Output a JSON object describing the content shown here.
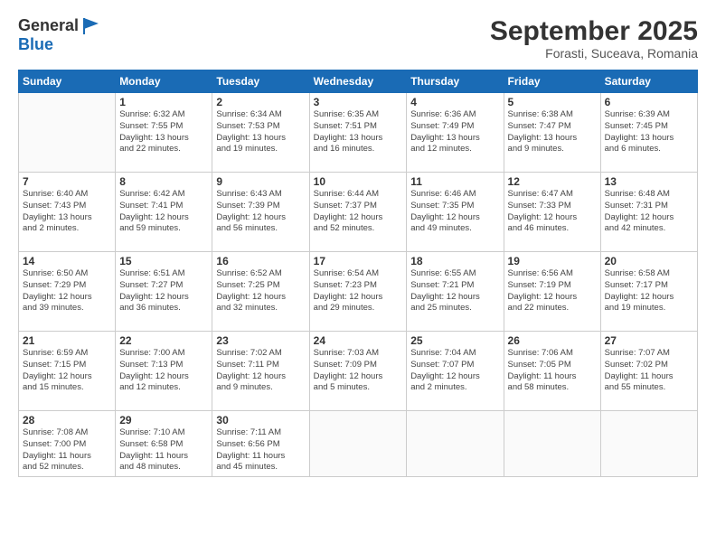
{
  "header": {
    "logo_line1": "General",
    "logo_line2": "Blue",
    "month_year": "September 2025",
    "location": "Forasti, Suceava, Romania"
  },
  "weekdays": [
    "Sunday",
    "Monday",
    "Tuesday",
    "Wednesday",
    "Thursday",
    "Friday",
    "Saturday"
  ],
  "weeks": [
    [
      {
        "day": "",
        "info": ""
      },
      {
        "day": "1",
        "info": "Sunrise: 6:32 AM\nSunset: 7:55 PM\nDaylight: 13 hours\nand 22 minutes."
      },
      {
        "day": "2",
        "info": "Sunrise: 6:34 AM\nSunset: 7:53 PM\nDaylight: 13 hours\nand 19 minutes."
      },
      {
        "day": "3",
        "info": "Sunrise: 6:35 AM\nSunset: 7:51 PM\nDaylight: 13 hours\nand 16 minutes."
      },
      {
        "day": "4",
        "info": "Sunrise: 6:36 AM\nSunset: 7:49 PM\nDaylight: 13 hours\nand 12 minutes."
      },
      {
        "day": "5",
        "info": "Sunrise: 6:38 AM\nSunset: 7:47 PM\nDaylight: 13 hours\nand 9 minutes."
      },
      {
        "day": "6",
        "info": "Sunrise: 6:39 AM\nSunset: 7:45 PM\nDaylight: 13 hours\nand 6 minutes."
      }
    ],
    [
      {
        "day": "7",
        "info": "Sunrise: 6:40 AM\nSunset: 7:43 PM\nDaylight: 13 hours\nand 2 minutes."
      },
      {
        "day": "8",
        "info": "Sunrise: 6:42 AM\nSunset: 7:41 PM\nDaylight: 12 hours\nand 59 minutes."
      },
      {
        "day": "9",
        "info": "Sunrise: 6:43 AM\nSunset: 7:39 PM\nDaylight: 12 hours\nand 56 minutes."
      },
      {
        "day": "10",
        "info": "Sunrise: 6:44 AM\nSunset: 7:37 PM\nDaylight: 12 hours\nand 52 minutes."
      },
      {
        "day": "11",
        "info": "Sunrise: 6:46 AM\nSunset: 7:35 PM\nDaylight: 12 hours\nand 49 minutes."
      },
      {
        "day": "12",
        "info": "Sunrise: 6:47 AM\nSunset: 7:33 PM\nDaylight: 12 hours\nand 46 minutes."
      },
      {
        "day": "13",
        "info": "Sunrise: 6:48 AM\nSunset: 7:31 PM\nDaylight: 12 hours\nand 42 minutes."
      }
    ],
    [
      {
        "day": "14",
        "info": "Sunrise: 6:50 AM\nSunset: 7:29 PM\nDaylight: 12 hours\nand 39 minutes."
      },
      {
        "day": "15",
        "info": "Sunrise: 6:51 AM\nSunset: 7:27 PM\nDaylight: 12 hours\nand 36 minutes."
      },
      {
        "day": "16",
        "info": "Sunrise: 6:52 AM\nSunset: 7:25 PM\nDaylight: 12 hours\nand 32 minutes."
      },
      {
        "day": "17",
        "info": "Sunrise: 6:54 AM\nSunset: 7:23 PM\nDaylight: 12 hours\nand 29 minutes."
      },
      {
        "day": "18",
        "info": "Sunrise: 6:55 AM\nSunset: 7:21 PM\nDaylight: 12 hours\nand 25 minutes."
      },
      {
        "day": "19",
        "info": "Sunrise: 6:56 AM\nSunset: 7:19 PM\nDaylight: 12 hours\nand 22 minutes."
      },
      {
        "day": "20",
        "info": "Sunrise: 6:58 AM\nSunset: 7:17 PM\nDaylight: 12 hours\nand 19 minutes."
      }
    ],
    [
      {
        "day": "21",
        "info": "Sunrise: 6:59 AM\nSunset: 7:15 PM\nDaylight: 12 hours\nand 15 minutes."
      },
      {
        "day": "22",
        "info": "Sunrise: 7:00 AM\nSunset: 7:13 PM\nDaylight: 12 hours\nand 12 minutes."
      },
      {
        "day": "23",
        "info": "Sunrise: 7:02 AM\nSunset: 7:11 PM\nDaylight: 12 hours\nand 9 minutes."
      },
      {
        "day": "24",
        "info": "Sunrise: 7:03 AM\nSunset: 7:09 PM\nDaylight: 12 hours\nand 5 minutes."
      },
      {
        "day": "25",
        "info": "Sunrise: 7:04 AM\nSunset: 7:07 PM\nDaylight: 12 hours\nand 2 minutes."
      },
      {
        "day": "26",
        "info": "Sunrise: 7:06 AM\nSunset: 7:05 PM\nDaylight: 11 hours\nand 58 minutes."
      },
      {
        "day": "27",
        "info": "Sunrise: 7:07 AM\nSunset: 7:02 PM\nDaylight: 11 hours\nand 55 minutes."
      }
    ],
    [
      {
        "day": "28",
        "info": "Sunrise: 7:08 AM\nSunset: 7:00 PM\nDaylight: 11 hours\nand 52 minutes."
      },
      {
        "day": "29",
        "info": "Sunrise: 7:10 AM\nSunset: 6:58 PM\nDaylight: 11 hours\nand 48 minutes."
      },
      {
        "day": "30",
        "info": "Sunrise: 7:11 AM\nSunset: 6:56 PM\nDaylight: 11 hours\nand 45 minutes."
      },
      {
        "day": "",
        "info": ""
      },
      {
        "day": "",
        "info": ""
      },
      {
        "day": "",
        "info": ""
      },
      {
        "day": "",
        "info": ""
      }
    ]
  ]
}
